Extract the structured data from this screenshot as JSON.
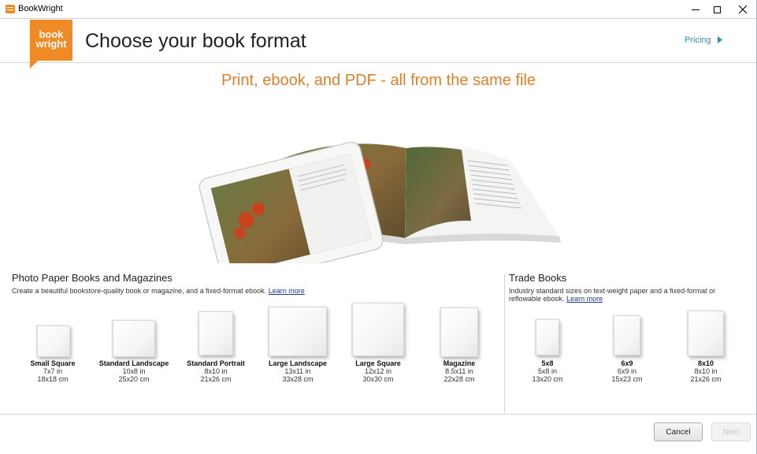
{
  "window": {
    "title": "BookWright"
  },
  "header": {
    "logo_line1": "book",
    "logo_line2": "wright",
    "title": "Choose your book format",
    "pricing_label": "Pricing"
  },
  "tagline": "Print, ebook, and PDF - all from the same file",
  "photo_books": {
    "heading": "Photo Paper Books and Magazines",
    "description": "Create a beautiful bookstore-quality book or magazine, and a fixed-format ebook.",
    "learn_more": "Learn more",
    "formats": [
      {
        "name": "Small Square",
        "inches": "7x7 in",
        "cm": "18x18 cm"
      },
      {
        "name": "Standard Landscape",
        "inches": "10x8 in",
        "cm": "25x20 cm"
      },
      {
        "name": "Standard Portrait",
        "inches": "8x10 in",
        "cm": "21x26 cm"
      },
      {
        "name": "Large Landscape",
        "inches": "13x11 in",
        "cm": "33x28 cm"
      },
      {
        "name": "Large Square",
        "inches": "12x12 in",
        "cm": "30x30 cm"
      },
      {
        "name": "Magazine",
        "inches": "8.5x11 in",
        "cm": "22x28 cm"
      }
    ]
  },
  "trade_books": {
    "heading": "Trade Books",
    "description": "Industry standard sizes on text-weight paper and a fixed-format or reflowable ebook.",
    "learn_more": "Learn more",
    "formats": [
      {
        "name": "5x8",
        "inches": "5x8 in",
        "cm": "13x20 cm"
      },
      {
        "name": "6x9",
        "inches": "6x9 in",
        "cm": "15x23 cm"
      },
      {
        "name": "8x10",
        "inches": "8x10 in",
        "cm": "21x26 cm"
      }
    ]
  },
  "footer": {
    "cancel_label": "Cancel",
    "next_label": "Next"
  },
  "colors": {
    "brand_orange": "#f08a24",
    "tagline_orange": "#e07f2a",
    "link_blue": "#2a8fc7"
  }
}
